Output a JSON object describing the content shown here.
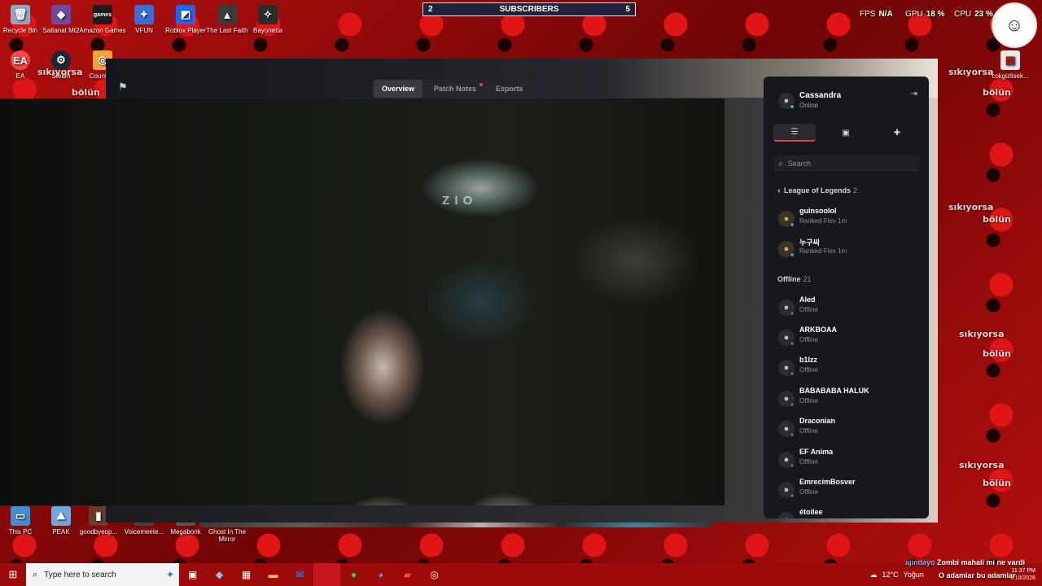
{
  "overlay": {
    "subscribers": {
      "left": "2",
      "label": "SUBSCRIBERS",
      "right": "5"
    },
    "fps_label": "FPS",
    "fps_value": "N/A",
    "gpu_label": "GPU",
    "gpu_value": "18 %",
    "cpu_label": "CPU",
    "cpu_value": "23 %",
    "wall_tags": [
      "sıkıyorsa",
      "bölün"
    ]
  },
  "desktop_icons": [
    {
      "label": "Recycle Bin",
      "icon": "recycle-bin-icon",
      "color": "#8fa7c2"
    },
    {
      "label": "Saltanat Mt2",
      "icon": "game-icon",
      "color": "#6b4aa0"
    },
    {
      "label": "Amazon Games",
      "icon": "amazon-games-icon",
      "color": "#1d1d1d"
    },
    {
      "label": "VFUN",
      "icon": "vfun-icon",
      "color": "#3b6fd6"
    },
    {
      "label": "Roblox Player",
      "icon": "roblox-icon",
      "color": "#2563eb"
    },
    {
      "label": "The Last Faith",
      "icon": "game-icon",
      "color": "#3a3a3a"
    },
    {
      "label": "Bayonetta",
      "icon": "game-icon",
      "color": "#2b2b2b"
    },
    {
      "label": "EA",
      "icon": "ea-icon",
      "color": "#ff4747"
    },
    {
      "label": "Steam",
      "icon": "steam-icon",
      "color": "#1b2838"
    },
    {
      "label": "Counte...",
      "icon": "counter-strike-icon",
      "color": "#f2a33a"
    },
    {
      "label": "cokgizlisek...",
      "icon": "file-icon",
      "color": "#e8e8e8"
    },
    {
      "label": "This PC",
      "icon": "computer-icon",
      "color": "#3e8ed0"
    },
    {
      "label": "PEAK",
      "icon": "game-icon",
      "color": "#6ea8dc"
    },
    {
      "label": "goodbyeop...",
      "icon": "game-icon",
      "color": "#6a3a2a"
    },
    {
      "label": "Voicemeete...",
      "icon": "app-icon",
      "color": "#444"
    },
    {
      "label": "Megabonk",
      "icon": "game-icon",
      "color": "#555"
    },
    {
      "label": "Ghost In The Mirror",
      "icon": "game-icon",
      "color": "#777"
    }
  ],
  "client": {
    "tabs": [
      {
        "label": "Overview",
        "active": true
      },
      {
        "label": "Patch Notes",
        "active": false,
        "dot": true
      },
      {
        "label": "Esports",
        "active": false
      }
    ],
    "minimize": "—",
    "close": "✕",
    "webcam_text": "Z I O"
  },
  "friends_panel": {
    "user": {
      "name": "Cassandra",
      "status": "Online"
    },
    "tools": [
      {
        "name": "friend-list-icon",
        "glyph": "☰"
      },
      {
        "name": "chat-icon",
        "glyph": "▣"
      },
      {
        "name": "add-friend-icon",
        "glyph": "✚"
      }
    ],
    "search_placeholder": "Search",
    "groups": [
      {
        "title": "League of Legends",
        "count": "2",
        "icon": "league-icon",
        "friends": [
          {
            "name": "guinsoolol",
            "sub": "Ranked Flex 1m",
            "online": true
          },
          {
            "name": "누구씨",
            "sub": "Ranked Flex 1m",
            "online": true
          }
        ]
      },
      {
        "title": "Offline",
        "count": "21",
        "friends": [
          {
            "name": "Aled",
            "sub": "Offline"
          },
          {
            "name": "ARKBOAA",
            "sub": "Offline"
          },
          {
            "name": "b1lzz",
            "sub": "Offline"
          },
          {
            "name": "BABABABA HALUK",
            "sub": "Offline"
          },
          {
            "name": "Draconian",
            "sub": "Offline"
          },
          {
            "name": "EF Anima",
            "sub": "Offline"
          },
          {
            "name": "EmrecimBosver",
            "sub": "Offline"
          },
          {
            "name": "étoilee",
            "sub": ""
          }
        ]
      }
    ]
  },
  "taskbar": {
    "search_placeholder": "Type here to search",
    "weather": "12°C",
    "weather_text": "Yoğun",
    "chat": [
      {
        "user": "ajindayo",
        "text": "Zombi mahali mi ne vardi"
      },
      {
        "user": "",
        "text": "O adamlar bu adamlar"
      }
    ],
    "time": "11:37 PM",
    "date": "1/10/2026"
  },
  "colors": {
    "accent": "#e0453f",
    "online": "#3fbf5f",
    "in_game": "#2a9fd6",
    "offline": "#5f6066"
  }
}
